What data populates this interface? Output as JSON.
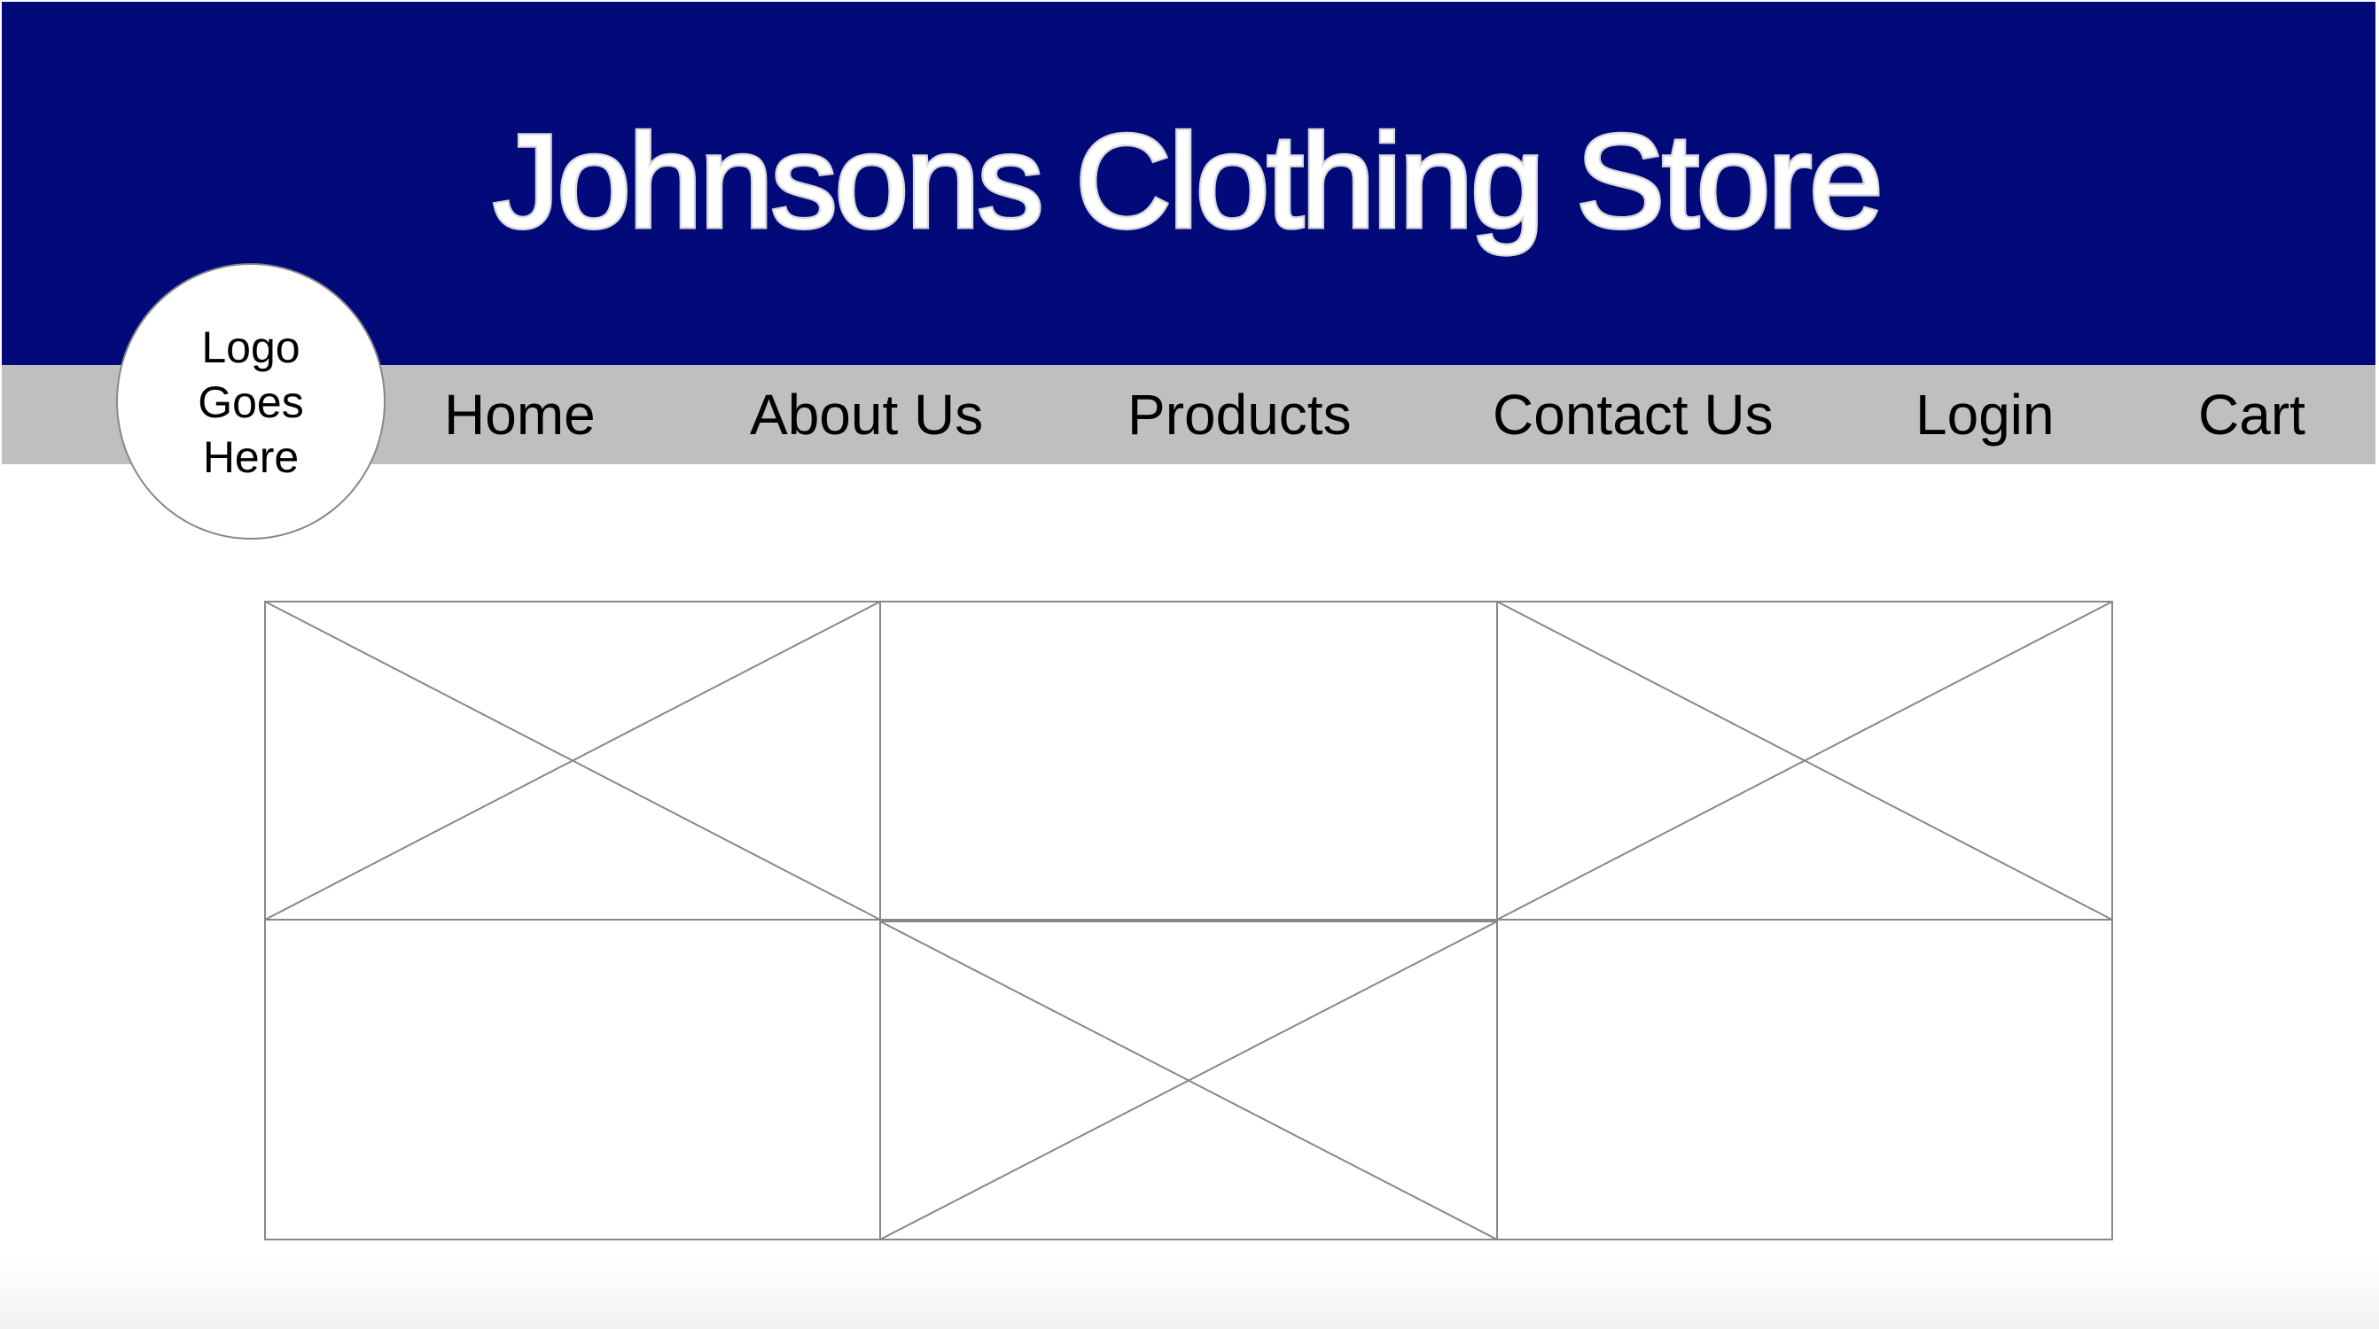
{
  "site": {
    "title": "Johnsons Clothing Store"
  },
  "logo": {
    "text": "Logo\nGoes\nHere"
  },
  "nav": {
    "items": [
      {
        "label": "Home"
      },
      {
        "label": "About Us"
      },
      {
        "label": "Products"
      },
      {
        "label": "Contact Us"
      },
      {
        "label": "Login"
      },
      {
        "label": "Cart"
      }
    ]
  },
  "gallery": {
    "rows": 2,
    "columns": 3,
    "cells": [
      {
        "row": 1,
        "column": 1,
        "placeholder": "x-image-placeholder"
      },
      {
        "row": 1,
        "column": 2,
        "placeholder": "blank-image-placeholder"
      },
      {
        "row": 1,
        "column": 3,
        "placeholder": "x-image-placeholder"
      },
      {
        "row": 2,
        "column": 1,
        "placeholder": "blank-image-placeholder"
      },
      {
        "row": 2,
        "column": 2,
        "placeholder": "x-image-placeholder"
      },
      {
        "row": 2,
        "column": 3,
        "placeholder": "blank-image-placeholder"
      }
    ]
  },
  "colors": {
    "header": "#020a7a",
    "nav": "#bfbfbf",
    "title_fill": "#ffffff",
    "title_outline": "#d9d9d9",
    "placeholder_line": "#888888"
  }
}
